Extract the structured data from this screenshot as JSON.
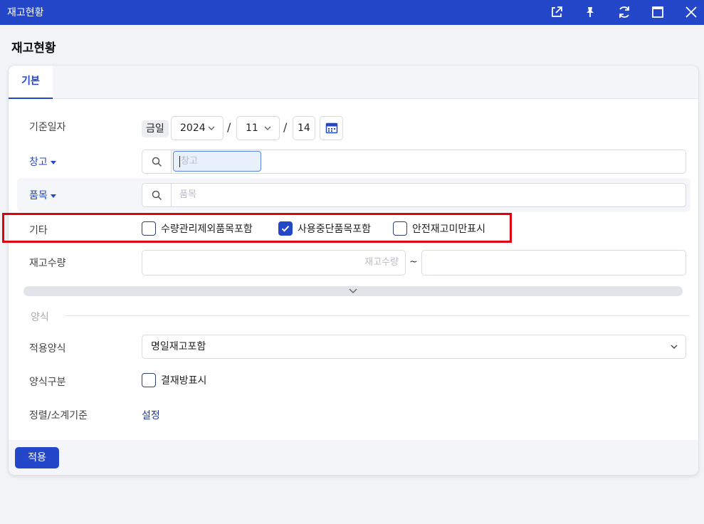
{
  "window": {
    "title": "재고현황",
    "icons": [
      "external-link-icon",
      "pin-icon",
      "refresh-icon",
      "maximize-icon",
      "close-icon"
    ]
  },
  "page_title": "재고현황",
  "tabs": [
    {
      "label": "기본",
      "active": true
    }
  ],
  "form": {
    "base_date": {
      "label": "기준일자",
      "today_pill": "금일",
      "year": "2024",
      "month": "11",
      "day": "14",
      "separator": "/"
    },
    "warehouse": {
      "label": "창고",
      "placeholder": "창고"
    },
    "item": {
      "label": "품목",
      "placeholder": "품목"
    },
    "other": {
      "label": "기타",
      "options": [
        {
          "label": "수량관리제외품목포함",
          "checked": false
        },
        {
          "label": "사용중단품목포함",
          "checked": true
        },
        {
          "label": "안전재고미만표시",
          "checked": false
        }
      ]
    },
    "stock_qty": {
      "label": "재고수량",
      "placeholder": "재고수량",
      "range_sep": "~"
    }
  },
  "format_section": {
    "title": "양식",
    "apply_format": {
      "label": "적용양식",
      "value": "명일재고포함"
    },
    "format_type": {
      "label": "양식구분",
      "checkbox_label": "결재방표시",
      "checked": false
    },
    "sort": {
      "label": "정렬/소계기준",
      "link": "설정"
    }
  },
  "footer": {
    "apply_label": "적용"
  },
  "colors": {
    "accent": "#2447c9",
    "highlight": "#e0000f"
  }
}
